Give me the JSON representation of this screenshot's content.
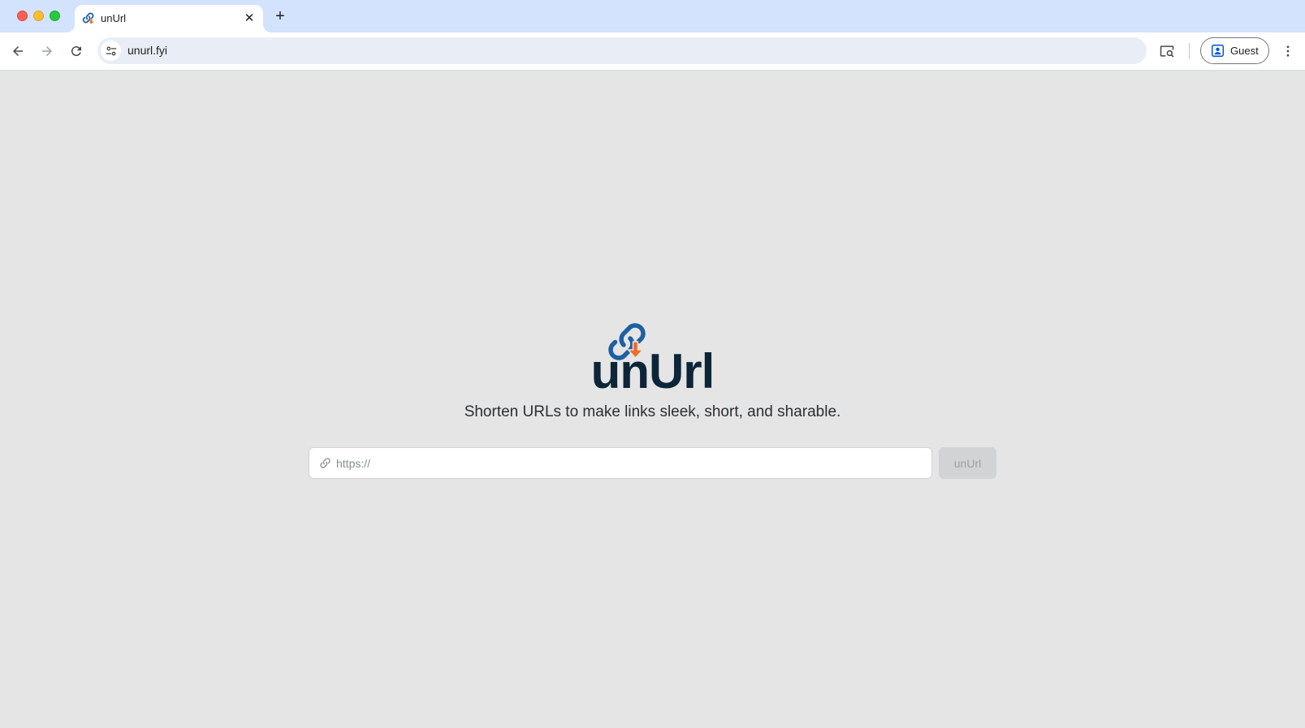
{
  "browser": {
    "tab": {
      "title": "unUrl",
      "close_glyph": "✕"
    },
    "new_tab_glyph": "+",
    "address": "unurl.fyi",
    "profile_label": "Guest",
    "icons": [
      "back-icon",
      "forward-icon",
      "reload-icon",
      "site-info-icon",
      "lens-search-icon",
      "guest-profile-icon",
      "kebab-menu-icon"
    ]
  },
  "page": {
    "brand": "unUrl",
    "tagline": "Shorten URLs to make links sleek, short, and sharable.",
    "url_field": {
      "placeholder": "https://",
      "value": ""
    },
    "submit_label": "unUrl"
  },
  "colors": {
    "tabstrip": "#d3e3fd",
    "page_background": "#e4e5e4",
    "brand_dark": "#0d2538",
    "logo_blue": "#1f5fa3",
    "logo_orange": "#f26b21",
    "button_disabled": "#d2d3d4"
  }
}
